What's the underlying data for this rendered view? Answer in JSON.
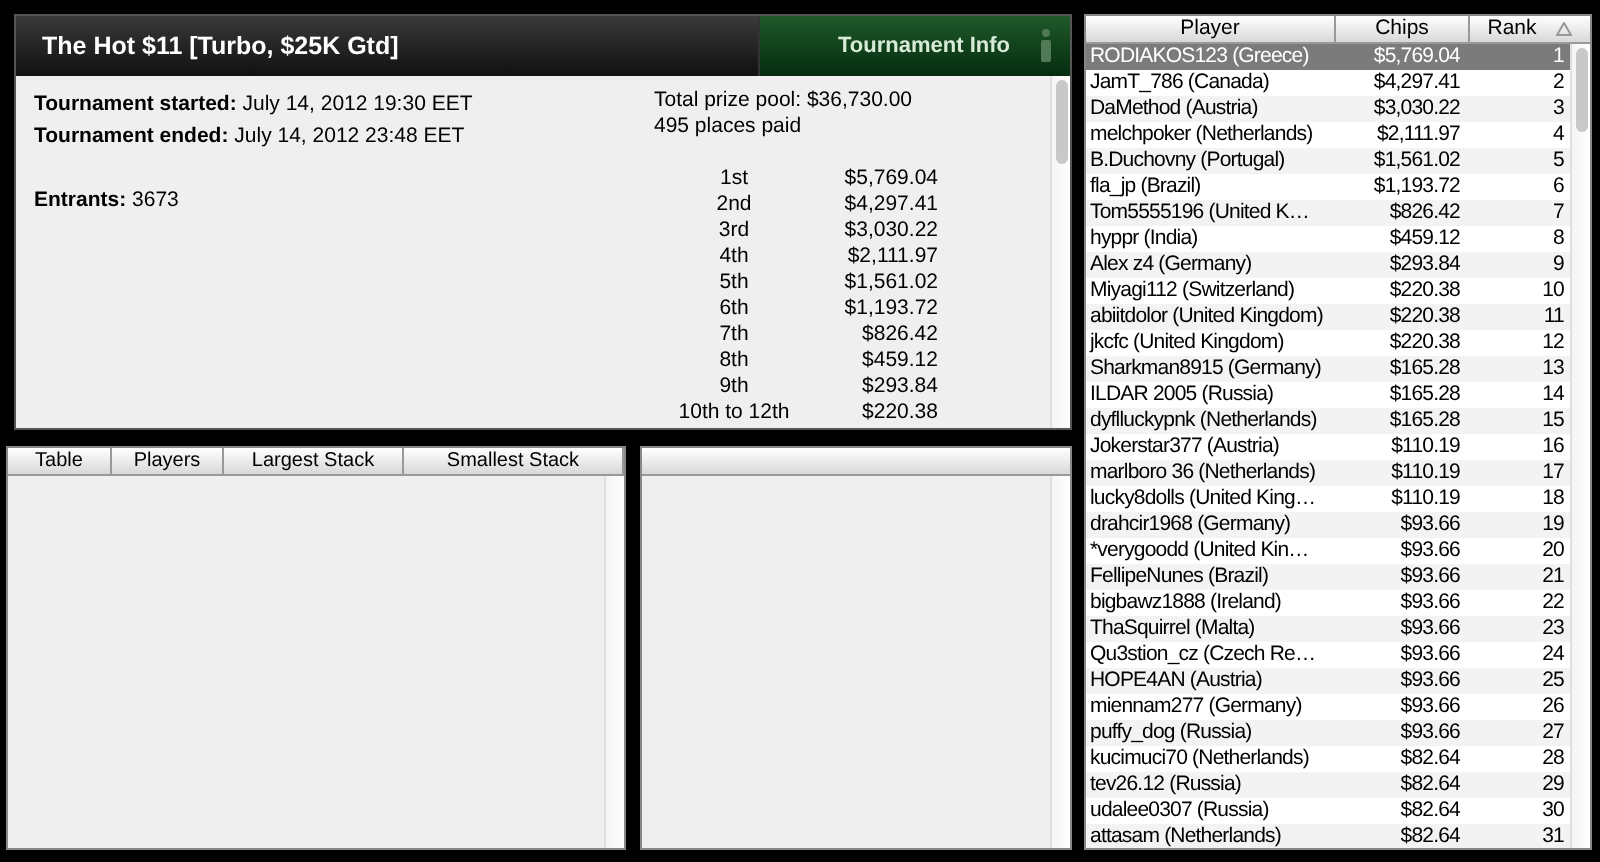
{
  "tournament": {
    "title": "The Hot $11 [Turbo, $25K Gtd]",
    "tab": "Tournament Info",
    "details": [
      {
        "label": "Tournament started:",
        "value": "July 14, 2012 19:30 EET"
      },
      {
        "label": "Tournament ended:",
        "value": "July 14, 2012 23:48 EET"
      },
      {
        "label": "Entrants:",
        "value": "3673"
      }
    ],
    "prize_pool": "Total prize pool: $36,730.00",
    "places_paid": "495 places paid",
    "payouts": [
      {
        "place": "1st",
        "amount": "$5,769.04"
      },
      {
        "place": "2nd",
        "amount": "$4,297.41"
      },
      {
        "place": "3rd",
        "amount": "$3,030.22"
      },
      {
        "place": "4th",
        "amount": "$2,111.97"
      },
      {
        "place": "5th",
        "amount": "$1,561.02"
      },
      {
        "place": "6th",
        "amount": "$1,193.72"
      },
      {
        "place": "7th",
        "amount": "$826.42"
      },
      {
        "place": "8th",
        "amount": "$459.12"
      },
      {
        "place": "9th",
        "amount": "$293.84"
      },
      {
        "place": "10th to 12th",
        "amount": "$220.38"
      }
    ]
  },
  "tables": {
    "columns": [
      "Table",
      "Players",
      "Largest Stack",
      "Smallest Stack"
    ]
  },
  "players": {
    "columns": [
      "Player",
      "Chips",
      "Rank"
    ],
    "rows": [
      {
        "player": "RODIAKOS123 (Greece)",
        "chips": "$5,769.04",
        "rank": "1",
        "selected": true
      },
      {
        "player": "JamT_786 (Canada)",
        "chips": "$4,297.41",
        "rank": "2",
        "selected": false
      },
      {
        "player": "DaMethod (Austria)",
        "chips": "$3,030.22",
        "rank": "3",
        "selected": false
      },
      {
        "player": "melchpoker (Netherlands)",
        "chips": "$2,111.97",
        "rank": "4",
        "selected": false
      },
      {
        "player": "B.Duchovny (Portugal)",
        "chips": "$1,561.02",
        "rank": "5",
        "selected": false
      },
      {
        "player": "fla_jp (Brazil)",
        "chips": "$1,193.72",
        "rank": "6",
        "selected": false
      },
      {
        "player": "Tom5555196 (United K…",
        "chips": "$826.42",
        "rank": "7",
        "selected": false
      },
      {
        "player": "hyppr (India)",
        "chips": "$459.12",
        "rank": "8",
        "selected": false
      },
      {
        "player": "Alex z4 (Germany)",
        "chips": "$293.84",
        "rank": "9",
        "selected": false
      },
      {
        "player": "Miyagi112 (Switzerland)",
        "chips": "$220.38",
        "rank": "10",
        "selected": false
      },
      {
        "player": "abiitdolor (United Kingdom)",
        "chips": "$220.38",
        "rank": "11",
        "selected": false
      },
      {
        "player": "jkcfc (United Kingdom)",
        "chips": "$220.38",
        "rank": "12",
        "selected": false
      },
      {
        "player": "Sharkman8915 (Germany)",
        "chips": "$165.28",
        "rank": "13",
        "selected": false
      },
      {
        "player": "ILDAR 2005 (Russia)",
        "chips": "$165.28",
        "rank": "14",
        "selected": false
      },
      {
        "player": "dyflluckypnk (Netherlands)",
        "chips": "$165.28",
        "rank": "15",
        "selected": false
      },
      {
        "player": "Jokerstar377 (Austria)",
        "chips": "$110.19",
        "rank": "16",
        "selected": false
      },
      {
        "player": "marlboro 36 (Netherlands)",
        "chips": "$110.19",
        "rank": "17",
        "selected": false
      },
      {
        "player": "lucky8dolls (United King…",
        "chips": "$110.19",
        "rank": "18",
        "selected": false
      },
      {
        "player": "drahcir1968 (Germany)",
        "chips": "$93.66",
        "rank": "19",
        "selected": false
      },
      {
        "player": "*verygoodd (United Kin…",
        "chips": "$93.66",
        "rank": "20",
        "selected": false
      },
      {
        "player": "FellipeNunes (Brazil)",
        "chips": "$93.66",
        "rank": "21",
        "selected": false
      },
      {
        "player": "bigbawz1888 (Ireland)",
        "chips": "$93.66",
        "rank": "22",
        "selected": false
      },
      {
        "player": "ThaSquirrel (Malta)",
        "chips": "$93.66",
        "rank": "23",
        "selected": false
      },
      {
        "player": "Qu3stion_cz (Czech Re…",
        "chips": "$93.66",
        "rank": "24",
        "selected": false
      },
      {
        "player": "HOPE4AN (Austria)",
        "chips": "$93.66",
        "rank": "25",
        "selected": false
      },
      {
        "player": "miennam277 (Germany)",
        "chips": "$93.66",
        "rank": "26",
        "selected": false
      },
      {
        "player": "puffy_dog (Russia)",
        "chips": "$93.66",
        "rank": "27",
        "selected": false
      },
      {
        "player": "kucimuci70 (Netherlands)",
        "chips": "$82.64",
        "rank": "28",
        "selected": false
      },
      {
        "player": "tev26.12 (Russia)",
        "chips": "$82.64",
        "rank": "29",
        "selected": false
      },
      {
        "player": "udalee0307 (Russia)",
        "chips": "$82.64",
        "rank": "30",
        "selected": false
      },
      {
        "player": "attasam (Netherlands)",
        "chips": "$82.64",
        "rank": "31",
        "selected": false
      }
    ]
  }
}
